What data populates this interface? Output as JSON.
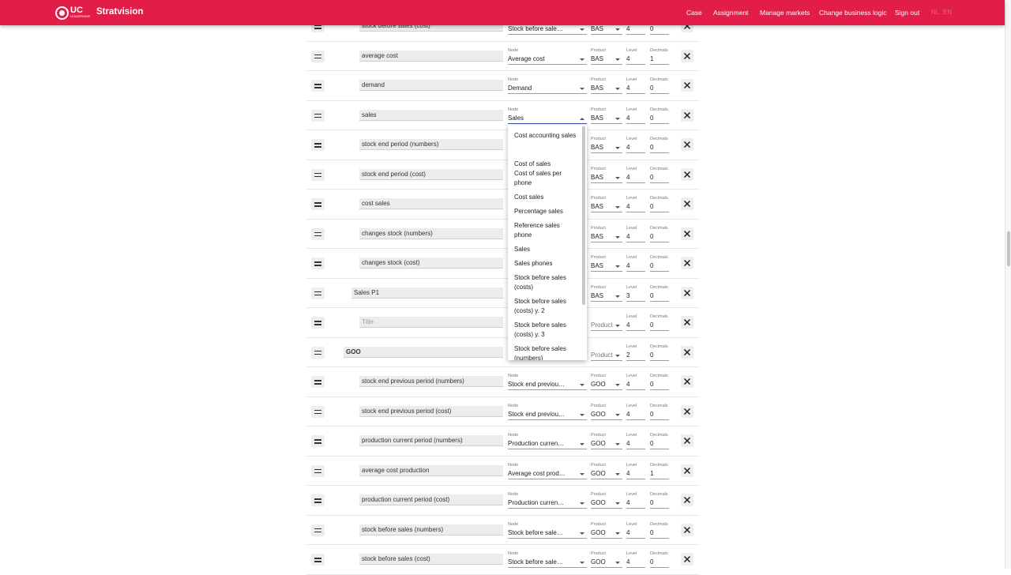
{
  "header": {
    "brand": "Stratvision",
    "logo_text": "UC",
    "logo_sub": "LEADERSHIP",
    "nav": [
      "Case",
      "Assignment",
      "Manage markets",
      "Change business logic",
      "Sign out"
    ],
    "lang": [
      "NL",
      "EN"
    ],
    "bar_color": "#e11d48"
  },
  "field_labels": {
    "node": "Node",
    "product": "Product",
    "level": "Level",
    "decimals": "Decimals"
  },
  "rows": [
    {
      "title": "stock before sales (cost)",
      "node": "Stock before sale…",
      "product": "BAS",
      "level": "4",
      "decimals": "0"
    },
    {
      "title": "average cost",
      "node": "Average cost",
      "product": "BAS",
      "level": "4",
      "decimals": "1"
    },
    {
      "title": "demand",
      "node": "Demand",
      "product": "BAS",
      "level": "4",
      "decimals": "0"
    },
    {
      "title": "sales",
      "node": "Sales",
      "product": "BAS",
      "level": "4",
      "decimals": "0"
    },
    {
      "title": "stock end period (numbers)",
      "node": "",
      "product": "BAS",
      "level": "4",
      "decimals": "0"
    },
    {
      "title": "stock end period (cost)",
      "node": "",
      "product": "BAS",
      "level": "4",
      "decimals": "0"
    },
    {
      "title": "cost sales",
      "node": "",
      "product": "BAS",
      "level": "4",
      "decimals": "0"
    },
    {
      "title": "changes stock (numbers)",
      "node": "",
      "product": "BAS",
      "level": "4",
      "decimals": "0"
    },
    {
      "title": "changes stock (cost)",
      "node": "",
      "product": "BAS",
      "level": "4",
      "decimals": "0"
    },
    {
      "title": "Sales P1",
      "node": "",
      "product": "BAS",
      "level": "3",
      "decimals": "0"
    },
    {
      "title": "",
      "node": "",
      "product": "Product",
      "level": "4",
      "decimals": "0"
    },
    {
      "title": "GOO",
      "node": "",
      "product": "Product",
      "level": "2",
      "decimals": "0"
    },
    {
      "title": "stock end previous period (numbers)",
      "node": "Stock end previou…",
      "product": "GOO",
      "level": "4",
      "decimals": "0"
    },
    {
      "title": "stock end previous period (cost)",
      "node": "Stock end previou…",
      "product": "GOO",
      "level": "4",
      "decimals": "0"
    },
    {
      "title": "production current period (numbers)",
      "node": "Production curren…",
      "product": "GOO",
      "level": "4",
      "decimals": "0"
    },
    {
      "title": "average cost production",
      "node": "Average cost prod…",
      "product": "GOO",
      "level": "4",
      "decimals": "1"
    },
    {
      "title": "production current period (cost)",
      "node": "Production curren…",
      "product": "GOO",
      "level": "4",
      "decimals": "0"
    },
    {
      "title": "stock before sales (numbers)",
      "node": "Stock before sale…",
      "product": "GOO",
      "level": "4",
      "decimals": "0"
    },
    {
      "title": "stock before sales (cost)",
      "node": "Stock before sale…",
      "product": "GOO",
      "level": "4",
      "decimals": "0"
    }
  ],
  "title_placeholder": "Title",
  "dropdown_options": [
    "Cost accounting sales",
    "Cost of sales",
    "Cost of sales per phone",
    "Cost sales",
    "Percentage sales",
    "Reference sales phone",
    "Sales",
    "Sales phones",
    "Stock before sales (costs)",
    "Stock before sales (costs) y. 2",
    "Stock before sales (costs) y. 3",
    "Stock before sales (numbers)"
  ]
}
